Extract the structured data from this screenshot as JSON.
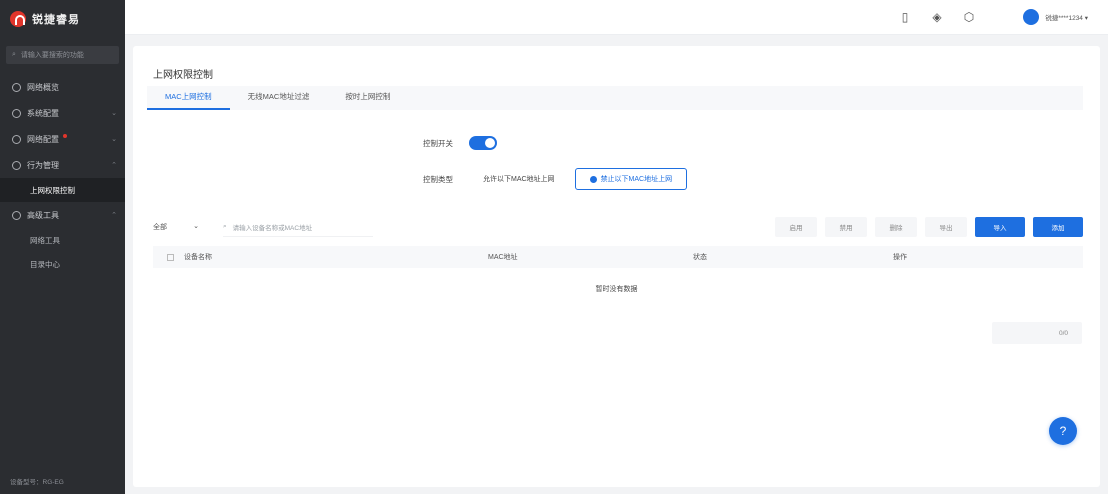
{
  "colors": {
    "accent": "#1e6fe0",
    "sidebar_bg": "#2b2d31",
    "brand_red": "#e0352b"
  },
  "brand": {
    "name": "锐捷睿易"
  },
  "sidebar": {
    "search_placeholder": "请输入要搜索的功能",
    "items": [
      {
        "label": "网络概览",
        "icon": "globe-icon",
        "has_children": false
      },
      {
        "label": "系统配置",
        "icon": "gear-icon",
        "has_children": true
      },
      {
        "label": "网络配置",
        "icon": "network-icon",
        "has_children": true,
        "badge": true
      },
      {
        "label": "行为管理",
        "icon": "shield-icon",
        "has_children": true
      },
      {
        "label": "高级工具",
        "icon": "tool-icon",
        "has_children": true
      }
    ],
    "active_sub": "上网权限控制",
    "tool_subs": [
      "网络工具",
      "目录中心"
    ],
    "footer": "设备型号：RG-EG"
  },
  "topbar": {
    "icons": [
      "phone-icon",
      "location-icon",
      "cube-icon"
    ],
    "user": "锐捷****1234 ▾"
  },
  "page": {
    "title": "上网权限控制",
    "tabs": [
      "MAC上网控制",
      "无线MAC地址过滤",
      "按时上网控制"
    ],
    "active_tab": 0,
    "form": {
      "switch_label": "控制开关",
      "switch_on": true,
      "type_label": "控制类型",
      "options": [
        "允许以下MAC地址上网",
        "禁止以下MAC地址上网"
      ],
      "selected_option": 1
    },
    "toolbar": {
      "select": "全部",
      "search_placeholder": "请输入设备名称或MAC地址",
      "buttons": [
        "启用",
        "禁用",
        "删除",
        "导出"
      ],
      "primary_buttons": [
        "导入",
        "添加"
      ]
    },
    "table": {
      "headers": [
        "设备名称",
        "MAC地址",
        "状态",
        "操作"
      ],
      "empty_text": "暂时没有数据"
    },
    "pager": "0/0"
  }
}
